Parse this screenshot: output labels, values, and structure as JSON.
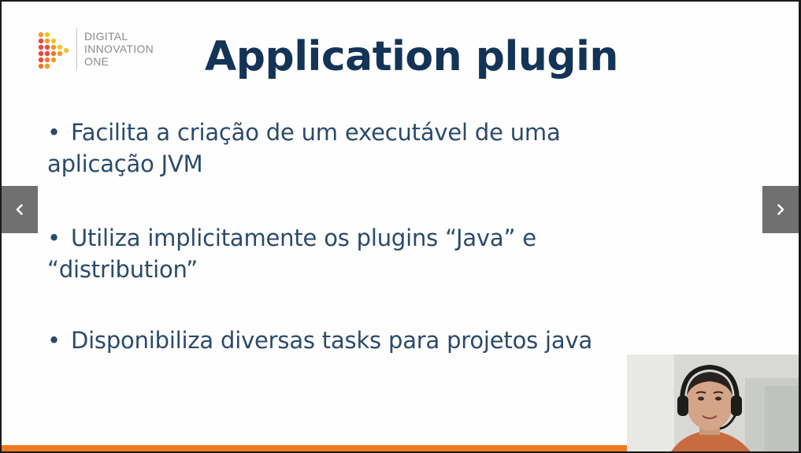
{
  "logo": {
    "line1": "DIGITAL",
    "line2": "INNOVATION",
    "line3": "ONE",
    "colors": [
      "#e84a3c",
      "#f39a1f",
      "#f6c12a",
      "#f2782b"
    ]
  },
  "slide": {
    "title": "Application plugin",
    "bullet_marker": "•",
    "bullets": [
      "Facilita a criação de um executável de uma aplicação JVM",
      "Utiliza implicitamente os plugins “Java” e “distribution”",
      "Disponibiliza diversas tasks para projetos java"
    ]
  },
  "navigation": {
    "prev_icon": "chevron-left-icon",
    "next_icon": "chevron-right-icon"
  },
  "colors": {
    "title": "#133456",
    "text": "#2b4a6b",
    "accent_bar": "#f07a22",
    "nav_bg": "#707070"
  }
}
